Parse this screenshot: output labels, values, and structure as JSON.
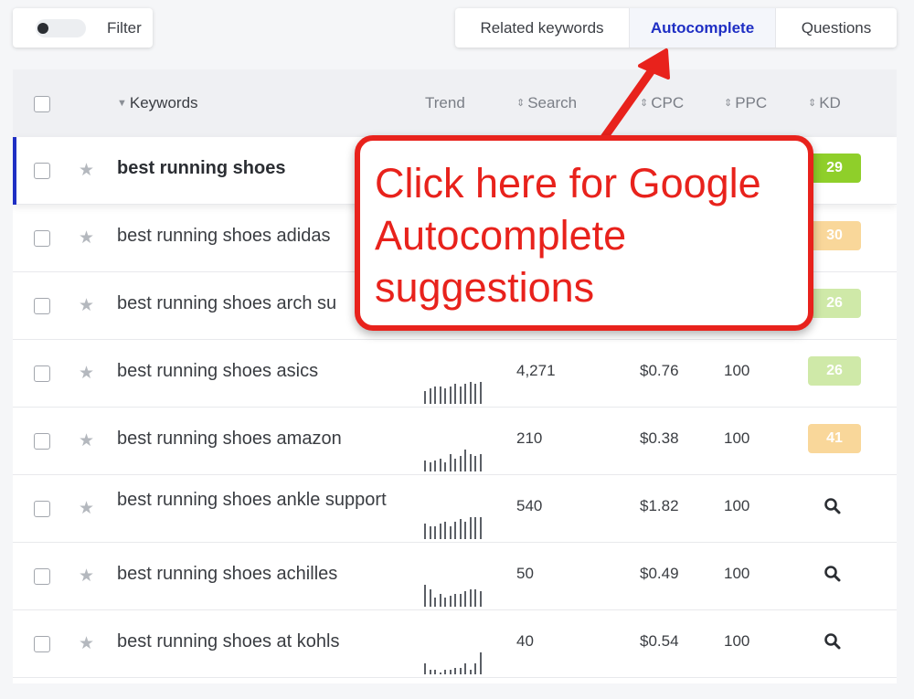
{
  "filter": {
    "label": "Filter"
  },
  "tabs": [
    {
      "label": "Related keywords"
    },
    {
      "label": "Autocomplete"
    },
    {
      "label": "Questions"
    }
  ],
  "table": {
    "headers": {
      "keywords": "Keywords",
      "trend": "Trend",
      "search": "Search",
      "cpc": "CPC",
      "ppc": "PPC",
      "kd": "KD"
    },
    "rows": [
      {
        "keyword": "best running shoes",
        "search": "",
        "cpc": "",
        "ppc": "",
        "kd": "29",
        "kd_color": "#8fcf2a",
        "trend": []
      },
      {
        "keyword": "best running shoes adidas",
        "search": "",
        "cpc": "",
        "ppc": "",
        "kd": "30",
        "kd_color": "#f9d79a",
        "trend": []
      },
      {
        "keyword": "best running shoes arch su",
        "search": "",
        "cpc": "",
        "ppc": "",
        "kd": "26",
        "kd_color": "#cfe9a8",
        "trend": []
      },
      {
        "keyword": "best running shoes asics",
        "search": "4,271",
        "cpc": "$0.76",
        "ppc": "100",
        "kd": "26",
        "kd_color": "#cfe9a8",
        "trend": [
          0.6,
          0.7,
          0.8,
          0.8,
          0.7,
          0.8,
          0.9,
          0.8,
          0.9,
          1,
          0.9,
          1
        ]
      },
      {
        "keyword": "best running shoes amazon",
        "search": "210",
        "cpc": "$0.38",
        "ppc": "100",
        "kd": "41",
        "kd_color": "#f9d79a",
        "trend": [
          0.5,
          0.4,
          0.5,
          0.6,
          0.4,
          0.8,
          0.6,
          0.7,
          1,
          0.8,
          0.7,
          0.8
        ]
      },
      {
        "keyword": "best running shoes ankle support",
        "search": "540",
        "cpc": "$1.82",
        "ppc": "100",
        "kd": "",
        "kd_color": "",
        "trend": [
          0.7,
          0.6,
          0.6,
          0.7,
          0.8,
          0.6,
          0.8,
          0.9,
          0.8,
          1,
          1,
          1
        ]
      },
      {
        "keyword": "best running shoes achilles",
        "search": "50",
        "cpc": "$0.49",
        "ppc": "100",
        "kd": "",
        "kd_color": "",
        "trend": [
          1,
          0.8,
          0.4,
          0.6,
          0.4,
          0.5,
          0.6,
          0.6,
          0.7,
          0.8,
          0.8,
          0.7
        ]
      },
      {
        "keyword": "best running shoes at kohls",
        "search": "40",
        "cpc": "$0.54",
        "ppc": "100",
        "kd": "",
        "kd_color": "",
        "trend": [
          0.5,
          0.2,
          0.2,
          0.1,
          0.2,
          0.2,
          0.3,
          0.3,
          0.5,
          0.2,
          0.5,
          1
        ]
      }
    ]
  },
  "callout": {
    "text_line1": "Click here for Google",
    "text_line2": "Autocomplete",
    "text_line3": "suggestions",
    "color": "#e8221c"
  },
  "icons": {
    "star": "star-icon",
    "search": "search-icon",
    "sort": "sort-icon",
    "caret": "caret-down-icon"
  }
}
